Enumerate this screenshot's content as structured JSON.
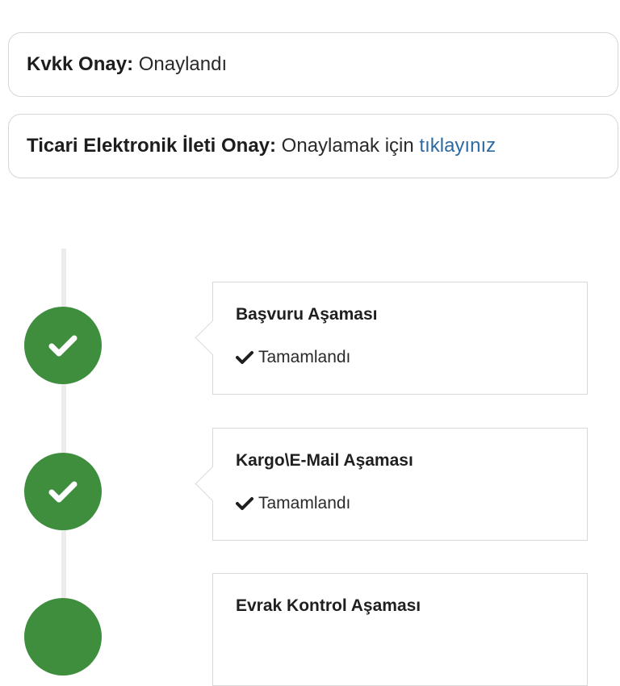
{
  "consents": [
    {
      "label": "Kvkk Onay:",
      "value": "Onaylandı",
      "link": ""
    },
    {
      "label": "Ticari Elektronik İleti Onay:",
      "value": "Onaylamak için",
      "link": "tıklayınız"
    }
  ],
  "steps": [
    {
      "title": "Başvuru Aşaması",
      "status": "Tamamlandı",
      "icon": "check-icon"
    },
    {
      "title": "Kargo\\E-Mail Aşaması",
      "status": "Tamamlandı",
      "icon": "check-icon"
    },
    {
      "title": "Evrak Kontrol Aşaması",
      "status": "",
      "icon": "check-icon"
    }
  ],
  "colors": {
    "success": "#3e8e3e",
    "link": "#2d6aa3",
    "border": "#d6d6d6"
  }
}
